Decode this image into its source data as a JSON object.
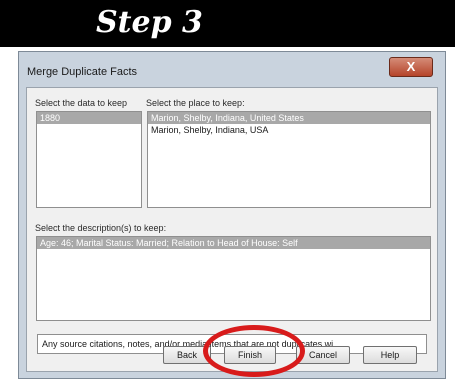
{
  "banner": {
    "title": "Step 3"
  },
  "dialog": {
    "title": "Merge Duplicate Facts",
    "close_label": "X",
    "data_label": "Select the data to keep",
    "data_items": [
      "1880"
    ],
    "place_label": "Select the place to keep:",
    "place_items": [
      "Marion, Shelby, Indiana, United States",
      "Marion, Shelby, Indiana, USA"
    ],
    "description_label": "Select the description(s) to keep:",
    "description_items": [
      "Age: 46; Marital Status: Married; Relation to Head of House: Self"
    ],
    "source_note": "Any source citations, notes, and/or media items that are not duplicates wi...",
    "buttons": {
      "back": "Back",
      "finish": "Finish",
      "cancel": "Cancel",
      "help": "Help"
    }
  },
  "colors": {
    "highlight_ring": "#d81b1b",
    "banner_bg": "#000000",
    "selection": "#a8a8a8"
  }
}
